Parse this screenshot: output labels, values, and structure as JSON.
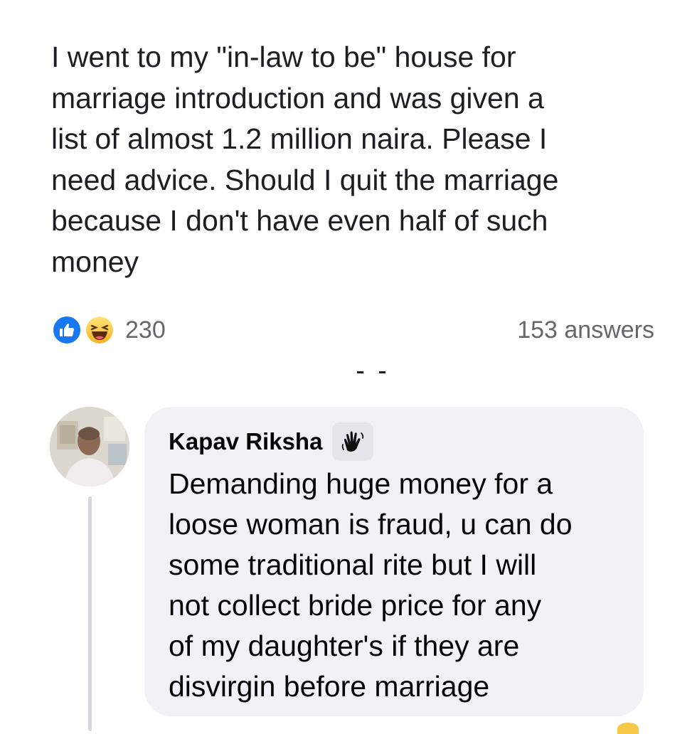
{
  "post": {
    "text": "I went to my \"in-law to be\" house for\nmarriage introduction and was given a\nlist of almost 1.2 million naira. Please I\nneed advice. Should I quit the marriage\nbecause I don't have even half of such\nmoney",
    "reactions": {
      "icons": [
        "like-icon",
        "haha-icon"
      ],
      "count": "230"
    },
    "answers_label": "153 answers"
  },
  "comment": {
    "author": "Kapav Riksha",
    "badge_icon": "waving-hand-icon",
    "text": "Demanding huge money for a\nloose woman is fraud, u can do\nsome traditional rite but I will\nnot collect bride price for any\nof my daughter's if they are\ndisvirgin before marriage"
  },
  "colors": {
    "like_blue": "#1877f2",
    "haha_yellow": "#f7c948",
    "bubble_bg": "#f0f2f5",
    "muted_text": "#65676b"
  }
}
